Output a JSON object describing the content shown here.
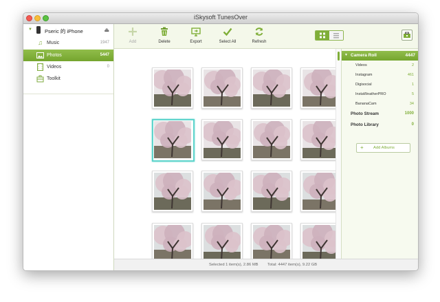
{
  "window": {
    "title": "iSkysoft TunesOver"
  },
  "sidebar": {
    "device": {
      "name": "Pseric 的 iPhone"
    },
    "items": [
      {
        "label": "Music",
        "count": "1947",
        "icon": "music-note-icon"
      },
      {
        "label": "Photos",
        "count": "5447",
        "icon": "photo-icon",
        "active": true
      },
      {
        "label": "Videos",
        "count": "0",
        "icon": "film-icon"
      },
      {
        "label": "Toolkit",
        "count": "",
        "icon": "toolkit-icon"
      }
    ]
  },
  "toolbar": {
    "add_label": "Add",
    "delete_label": "Delete",
    "export_label": "Export",
    "select_all_label": "Select All",
    "refresh_label": "Refresh"
  },
  "albums": {
    "camera_roll": {
      "name": "Camera Roll",
      "count": "4447"
    },
    "sub": [
      {
        "name": "Videos",
        "count": "2"
      },
      {
        "name": "Instagram",
        "count": "461"
      },
      {
        "name": "Digisocial",
        "count": "1"
      },
      {
        "name": "InstaWeatherPRO",
        "count": "5"
      },
      {
        "name": "BananaCam",
        "count": "34"
      }
    ],
    "top": [
      {
        "name": "Photo Stream",
        "count": "1000"
      },
      {
        "name": "Photo Library",
        "count": "0"
      }
    ],
    "add_label": "Add Albums"
  },
  "status": {
    "selected": "Selected 1 item(s), 2.86 MB",
    "total": "Total: 4447 item(s), 9.22 GB"
  },
  "colors": {
    "accent": "#7fae38",
    "selection": "#5fd4cc",
    "blossom": "#d8b9c4"
  }
}
